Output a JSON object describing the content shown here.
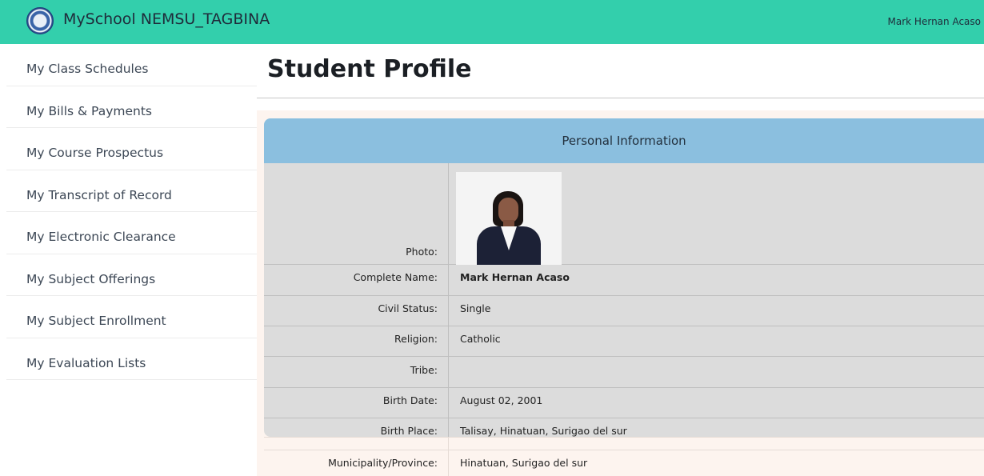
{
  "header": {
    "brand": "MySchool NEMSU_TAGBINA",
    "user_name": "Mark Hernan Acaso",
    "logo_icon": "school-seal-icon"
  },
  "sidebar": {
    "items": [
      {
        "label": "My Class Schedules"
      },
      {
        "label": "My Bills & Payments"
      },
      {
        "label": "My Course Prospectus"
      },
      {
        "label": "My Transcript of Record"
      },
      {
        "label": "My Electronic Clearance"
      },
      {
        "label": "My Subject Offerings"
      },
      {
        "label": "My Subject Enrollment"
      },
      {
        "label": "My Evaluation Lists"
      }
    ]
  },
  "main": {
    "title": "Student Profile",
    "card_title": "Personal Information",
    "fields": {
      "photo_label": "Photo:",
      "complete_name_label": "Complete Name:",
      "complete_name": "Mark Hernan Acaso",
      "civil_status_label": "Civil Status:",
      "civil_status": "Single",
      "religion_label": "Religion:",
      "religion": "Catholic",
      "tribe_label": "Tribe:",
      "tribe": "",
      "birth_date_label": "Birth Date:",
      "birth_date": "August 02, 2001",
      "birth_place_label": "Birth Place:",
      "birth_place": "Talisay, Hinatuan, Surigao del sur",
      "municipality_label": "Municipality/Province:",
      "municipality": "Hinatuan, Surigao del sur"
    }
  },
  "colors": {
    "topbar": "#33cfac",
    "card_header": "#8bbfdf",
    "card_body": "#dcdcdc"
  }
}
